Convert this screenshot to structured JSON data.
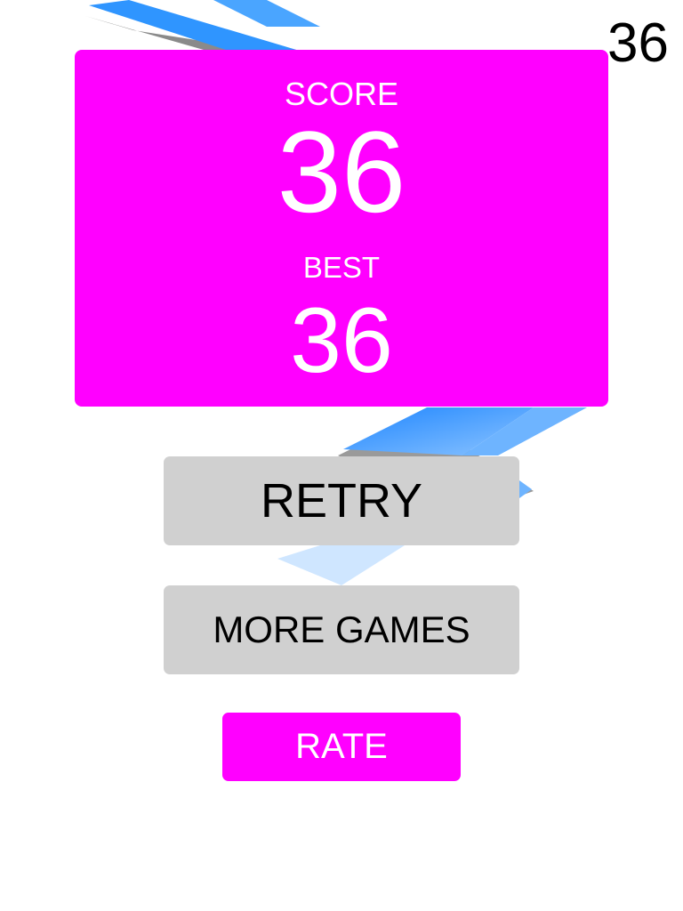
{
  "hud": {
    "current_score": "36"
  },
  "score_panel": {
    "score_label": "SCORE",
    "score_value": "36",
    "best_label": "BEST",
    "best_value": "36"
  },
  "buttons": {
    "retry_label": "RETRY",
    "more_games_label": "MORE GAMES",
    "rate_label": "RATE"
  },
  "colors": {
    "accent": "#ff00ff",
    "button_gray": "#d0d0d0",
    "track_blue": "#2f95ff",
    "track_light": "#cfe6ff",
    "shadow": "#8a8a8a"
  }
}
